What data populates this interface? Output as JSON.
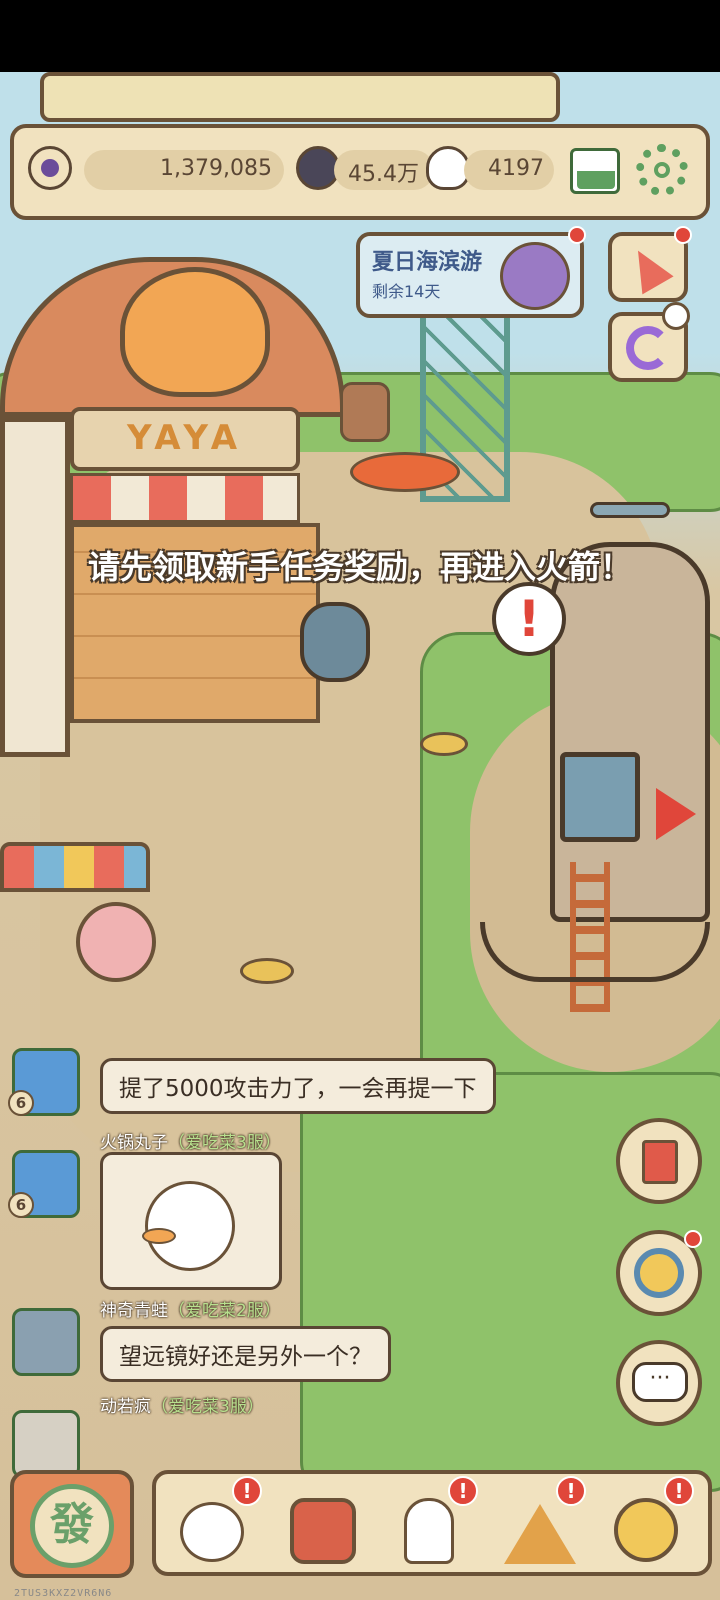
{
  "topbar": {
    "eye_value": "1,379,085",
    "gem_value": "45.4万",
    "soul_value": "4197",
    "icons": [
      "eye-icon",
      "dark-orb-icon",
      "ghost-icon",
      "mail-icon",
      "gear-icon"
    ]
  },
  "event": {
    "title": "夏日海滨游",
    "remaining": "剩余14天"
  },
  "notice": "请先领取新手任务奖励，再进入火箭！",
  "scene": {
    "shop_sign": "YAYA"
  },
  "chat": [
    {
      "name": "",
      "server": "",
      "level": "6",
      "message": "提了5000攻击力了，一会再提一下"
    },
    {
      "name": "火锅丸子",
      "server": "（爱吃菜3服）",
      "level": "6",
      "message": ""
    },
    {
      "name": "神奇青蛙",
      "server": "（爱吃菜2服）",
      "level": "",
      "message": "望远镜好还是另外一个？"
    },
    {
      "name": "动若疯",
      "server": "（爱吃菜3服）",
      "level": "",
      "message": ""
    }
  ],
  "bottom": {
    "main_label": "發",
    "items": [
      "duck-pet-icon",
      "backpack-icon",
      "bust-statue-icon",
      "pyramid-eye-icon",
      "key-coin-icon"
    ]
  },
  "version": "2TUS3KXZ2VR6N6",
  "colors": {
    "panel": "#f1e2bf",
    "border": "#6a5238",
    "alert": "#e0463a"
  }
}
